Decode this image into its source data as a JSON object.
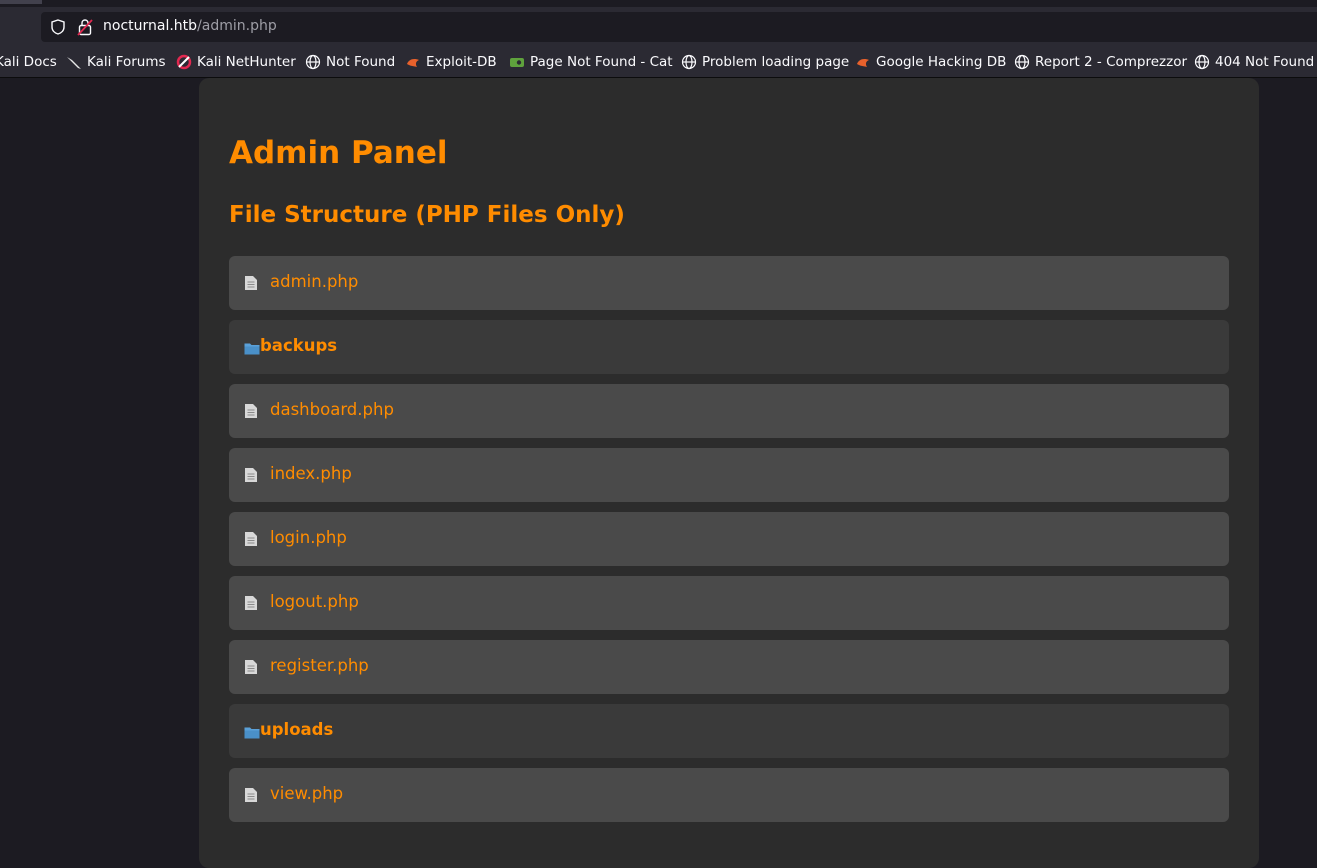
{
  "browser": {
    "url_host": "nocturnal.htb",
    "url_path": "/admin.php",
    "bookmarks": [
      {
        "label": "Kali Docs",
        "icon": "kali-dragon-icon"
      },
      {
        "label": "Kali Forums",
        "icon": "kali-dragon-icon"
      },
      {
        "label": "Kali NetHunter",
        "icon": "nethunter-icon"
      },
      {
        "label": "Not Found",
        "icon": "globe-icon"
      },
      {
        "label": "Exploit-DB",
        "icon": "exploitdb-icon"
      },
      {
        "label": "Page Not Found - Cat",
        "icon": "cat-icon"
      },
      {
        "label": "Problem loading page",
        "icon": "globe-icon"
      },
      {
        "label": "Google Hacking DB",
        "icon": "exploitdb-icon"
      },
      {
        "label": "Report 2 - Comprezzor",
        "icon": "globe-icon"
      },
      {
        "label": "404 Not Found",
        "icon": "globe-icon"
      }
    ]
  },
  "main": {
    "title": "Admin Panel",
    "subtitle": "File Structure (PHP Files Only)",
    "items": [
      {
        "type": "file",
        "name": "admin.php"
      },
      {
        "type": "folder",
        "name": "backups"
      },
      {
        "type": "file",
        "name": "dashboard.php"
      },
      {
        "type": "file",
        "name": "index.php"
      },
      {
        "type": "file",
        "name": "login.php"
      },
      {
        "type": "file",
        "name": "logout.php"
      },
      {
        "type": "file",
        "name": "register.php"
      },
      {
        "type": "folder",
        "name": "uploads"
      },
      {
        "type": "file",
        "name": "view.php"
      }
    ]
  },
  "colors": {
    "accent": "#ff8c00",
    "panel": "#2c2c2c",
    "file_row": "#4a4a4a",
    "folder_row": "#3a3a3a"
  }
}
